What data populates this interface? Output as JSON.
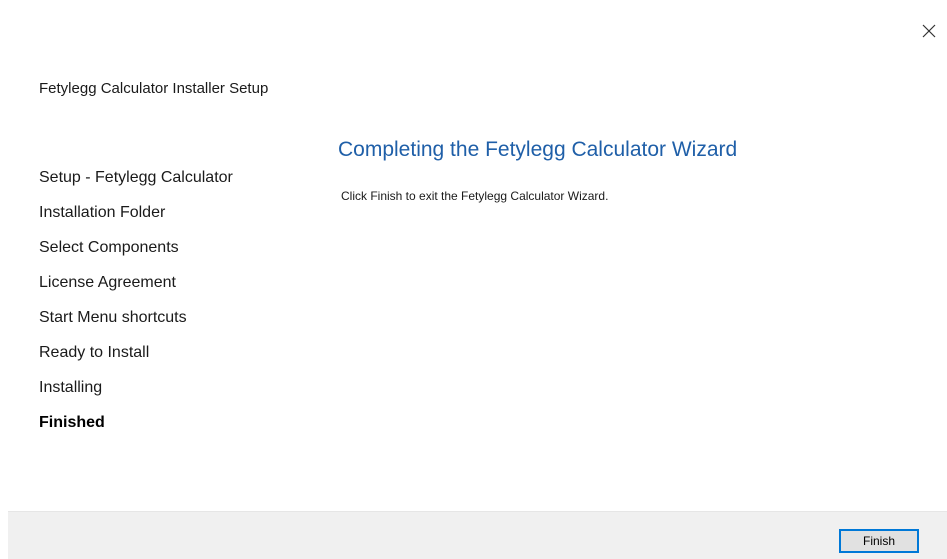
{
  "window": {
    "title": "Fetylegg Calculator Installer Setup",
    "close_icon": "close-icon"
  },
  "sidebar": {
    "steps": [
      {
        "label": "Setup - Fetylegg Calculator",
        "current": false
      },
      {
        "label": "Installation Folder",
        "current": false
      },
      {
        "label": "Select Components",
        "current": false
      },
      {
        "label": "License Agreement",
        "current": false
      },
      {
        "label": "Start Menu shortcuts",
        "current": false
      },
      {
        "label": "Ready to Install",
        "current": false
      },
      {
        "label": "Installing",
        "current": false
      },
      {
        "label": "Finished",
        "current": true
      }
    ]
  },
  "page": {
    "heading": "Completing the Fetylegg Calculator Wizard",
    "body": "Click Finish to exit the Fetylegg Calculator Wizard."
  },
  "footer": {
    "finish_label": "Finish"
  },
  "colors": {
    "heading": "#1f5fa8",
    "footer_bg": "#f0f0f0",
    "button_focus_border": "#0078d7"
  }
}
